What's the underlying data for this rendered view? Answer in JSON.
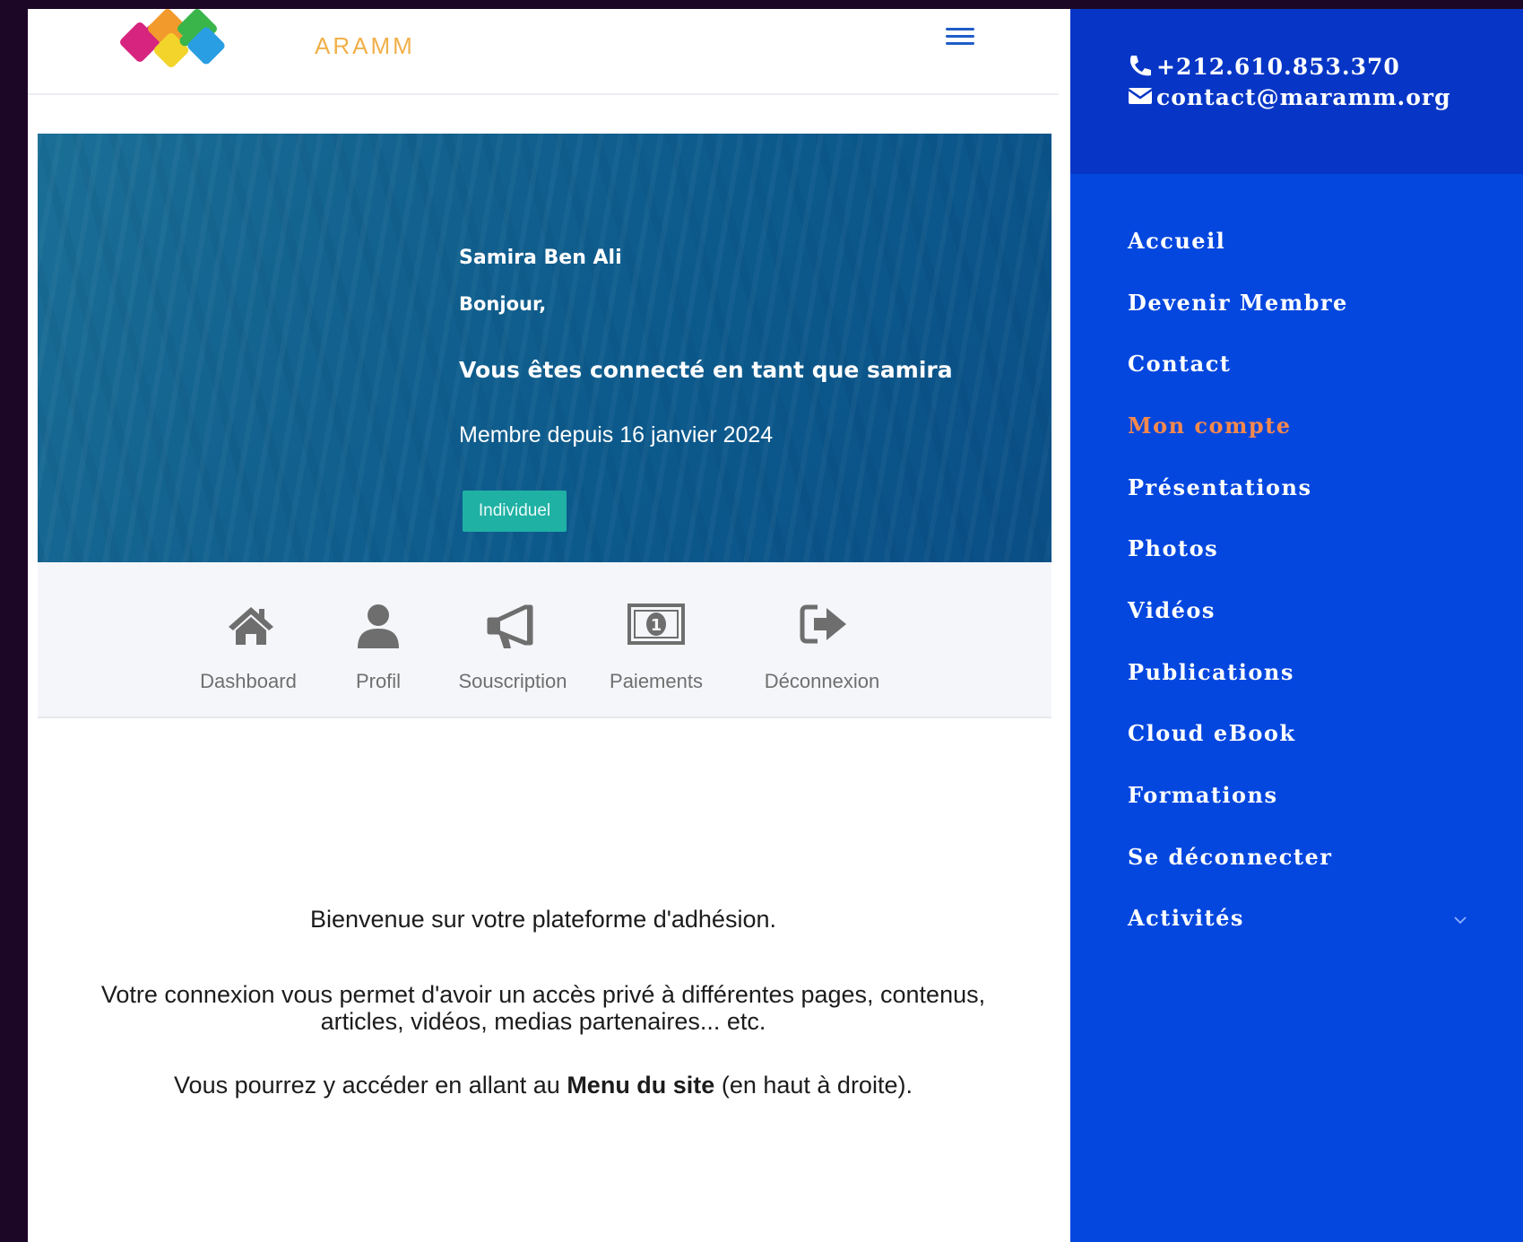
{
  "header": {
    "logo_text": "ARAMM",
    "menu_icon": "hamburger-icon"
  },
  "banner": {
    "name": "Samira Ben Ali",
    "greeting": "Bonjour,",
    "connected_as": "Vous êtes connecté en tant que samira",
    "member_since": "Membre depuis 16 janvier 2024",
    "badge": "Individuel"
  },
  "account_nav": [
    {
      "label": "Dashboard",
      "icon": "home-icon"
    },
    {
      "label": "Profil",
      "icon": "user-icon"
    },
    {
      "label": "Souscription",
      "icon": "megaphone-icon"
    },
    {
      "label": "Paiements",
      "icon": "money-icon"
    },
    {
      "label": "Déconnexion",
      "icon": "sign-out-icon"
    }
  ],
  "welcome": {
    "line1": "Bienvenue sur votre plateforme d'adhésion.",
    "line2a": "Votre connexion vous permet d'avoir un accès privé à différentes pages, contenus,",
    "line2b": "articles, vidéos, medias partenaires... etc.",
    "line3_pre": "Vous pourrez y accéder en allant au ",
    "line3_bold": "Menu du site",
    "line3_post": " (en haut à droite)."
  },
  "sidebar": {
    "phone": "+212.610.853.370",
    "email": "contact@maramm.org",
    "items": [
      {
        "label": "Accueil"
      },
      {
        "label": "Devenir Membre"
      },
      {
        "label": "Contact"
      },
      {
        "label": "Mon compte",
        "active": true
      },
      {
        "label": "Présentations"
      },
      {
        "label": "Photos"
      },
      {
        "label": "Vidéos"
      },
      {
        "label": "Publications"
      },
      {
        "label": "Cloud eBook"
      },
      {
        "label": "Formations"
      },
      {
        "label": "Se déconnecter"
      },
      {
        "label": "Activités",
        "has_submenu": true
      }
    ]
  },
  "colors": {
    "accent_active": "#f5894d",
    "sidebar_bg": "#0447df",
    "sidebar_top_bg": "#0736c6",
    "badge_bg": "#1fb1a4"
  }
}
